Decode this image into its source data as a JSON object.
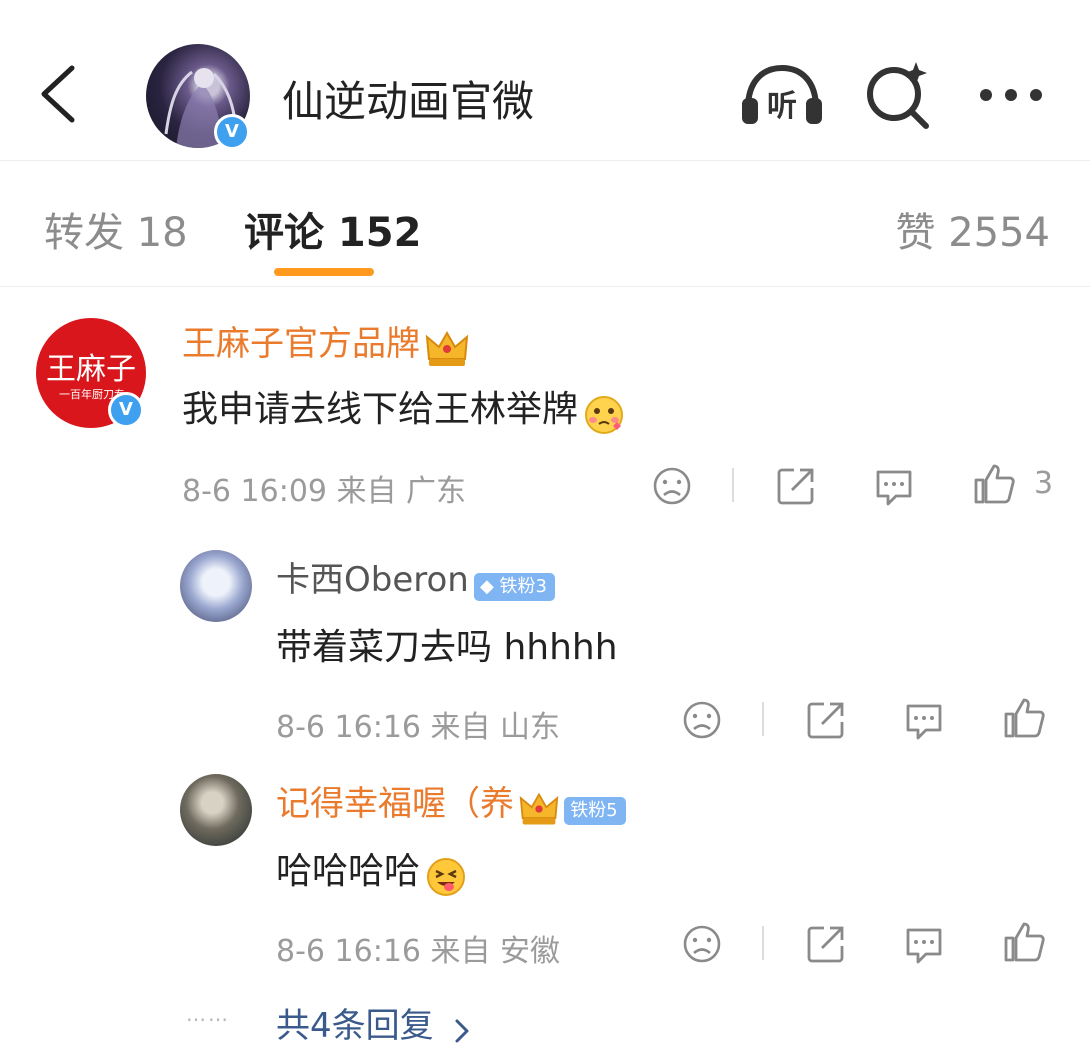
{
  "header": {
    "title": "仙逆动画官微",
    "verified_mark": "V",
    "icons": [
      "back-arrow-icon",
      "listen-icon",
      "search-sparkle-icon",
      "more-icon"
    ],
    "listen_label": "听"
  },
  "tabs": {
    "repost": "转发 18",
    "comment": "评论 152",
    "like": "赞 2554"
  },
  "comments": [
    {
      "name": "王麻子官方品牌",
      "avatar_text": "王麻子",
      "avatar_subtext": "一百年厨刀专",
      "text": "我申请去线下给王林举牌",
      "meta": "8-6 16:09 来自 广东",
      "like_count": "3"
    },
    {
      "name": "卡西Oberon",
      "badge": "铁粉3",
      "text": "带着菜刀去吗 hhhhh",
      "meta": "8-6 16:16 来自 山东"
    },
    {
      "name": "记得幸福喔（养",
      "badge": "铁粉5",
      "text": "哈哈哈哈",
      "meta": "8-6 16:16 来自 安徽"
    }
  ],
  "more_replies": {
    "dots": "……",
    "label": "共4条回复"
  },
  "colors": {
    "accent_orange": "#ea7a2c",
    "tab_underline": "#ff9a1f",
    "link_blue": "#3a5a8c",
    "verified_blue": "#3ea0ef",
    "fan_badge": "#7fb5f3",
    "brand_red": "#d9161c"
  }
}
